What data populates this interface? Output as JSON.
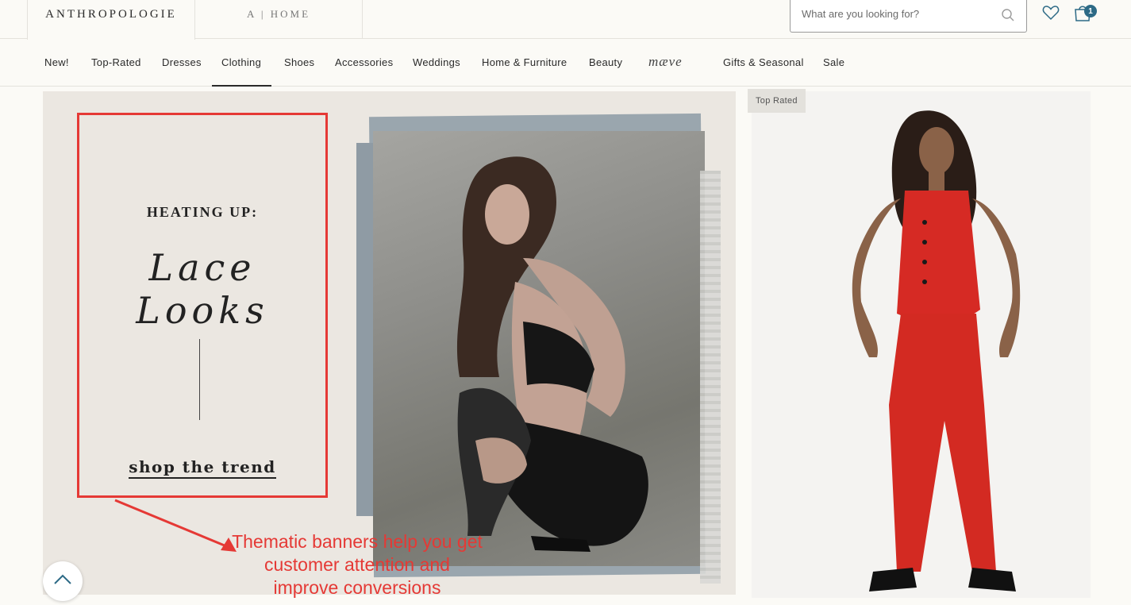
{
  "header": {
    "brand": "ANTHROPOLOGIE",
    "home_tab": "A | HOME",
    "search_placeholder": "What are you looking for?",
    "cart_count": "1"
  },
  "nav": {
    "items": [
      "New!",
      "Top-Rated",
      "Dresses",
      "Clothing",
      "Shoes",
      "Accessories",
      "Weddings",
      "Home & Furniture",
      "Beauty",
      "mæve",
      "Gifts & Seasonal",
      "Sale"
    ],
    "active": "Clothing"
  },
  "hero": {
    "kicker": "HEATING UP:",
    "title": "Lace Looks",
    "cta": "shop the trend"
  },
  "annotation": {
    "text": "Thematic banners help you get customer attention and improve conversions",
    "color": "#e53935"
  },
  "product": {
    "badge": "Top Rated"
  },
  "colors": {
    "accent": "#2d6a86",
    "annotation_red": "#e53935",
    "background": "#fbfaf6"
  }
}
